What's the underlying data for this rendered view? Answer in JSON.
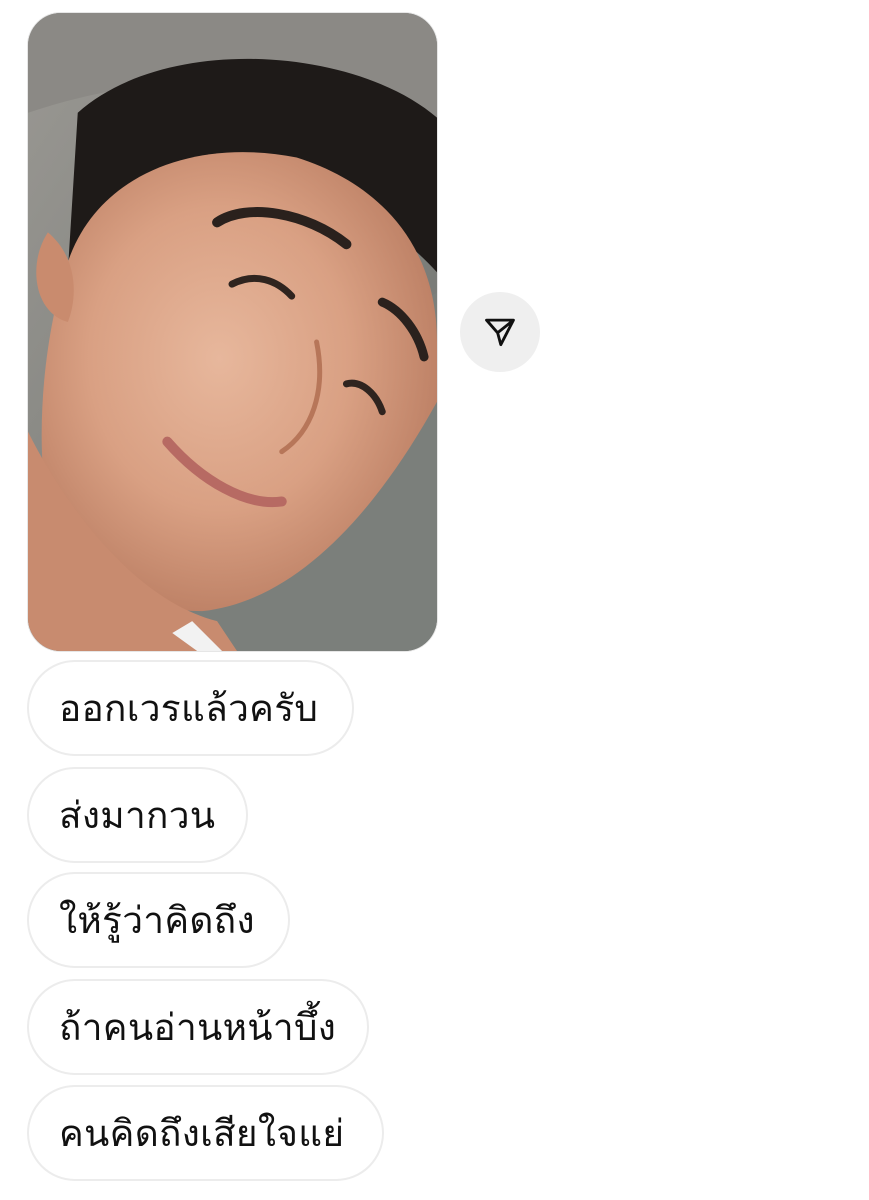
{
  "photo": {
    "subject": "selfie photo message"
  },
  "share": {
    "icon": "paper-plane-icon"
  },
  "messages": [
    "ออกเวรแล้วครับ",
    "ส่งมากวน",
    "ให้รู้ว่าคิดถึง",
    "ถ้าคนอ่านหน้าบึ้ง",
    "คนคิดถึงเสียใจแย่"
  ],
  "colors": {
    "bubble_border": "#ececec",
    "share_button_bg": "#efefef",
    "text": "#111111"
  }
}
